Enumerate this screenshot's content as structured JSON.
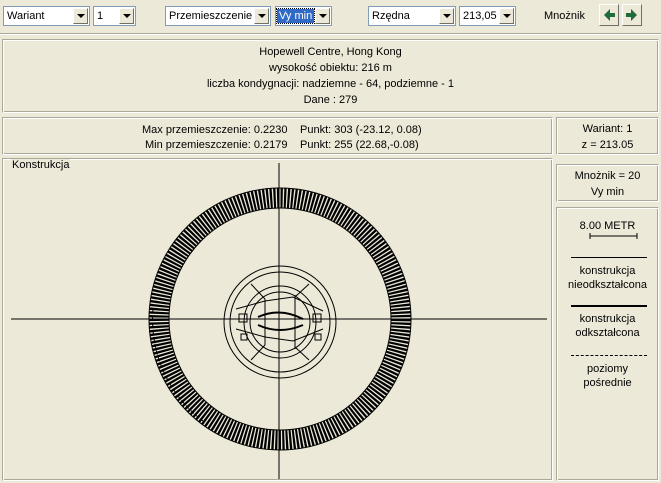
{
  "toolbar": {
    "combo_wariant": "Wariant",
    "combo_wariant_num": "1",
    "combo_przemieszczenie": "Przemieszczenie",
    "combo_vy": "Vy min",
    "combo_rzedna": "Rzędna",
    "combo_rzedna_val": "213,05",
    "mnoznik_label": "Mnożnik"
  },
  "info": {
    "line1": "Hopewell Centre, Hong Kong",
    "line2": "wysokość obiektu: 216 m",
    "line3": "liczba kondygnacji: nadziemne - 64, podziemne - 1",
    "line4": "Dane :   279"
  },
  "stats": {
    "max_label": "Max przemieszczenie: 0.2230",
    "max_punkt": "Punkt: 303 (-23.12, 0.08)",
    "min_label": "Min przemieszczenie: 0.2179",
    "min_punkt": "Punkt: 255 (22.68,-0.08)"
  },
  "wariant_box": {
    "line1": "Wariant: 1",
    "line2": "z = 213.05"
  },
  "canvas_title": "Konstrukcja",
  "mnoznik_box": {
    "line1": "Mnożnik = 20",
    "line2": "Vy min"
  },
  "legend": {
    "scale": "8.00  METR",
    "undeformed_1": "konstrukcja",
    "undeformed_2": "nieodkształcona",
    "deformed_1": "konstrukcja",
    "deformed_2": "odkształcona",
    "levels_1": "poziomy",
    "levels_2": "pośrednie"
  }
}
